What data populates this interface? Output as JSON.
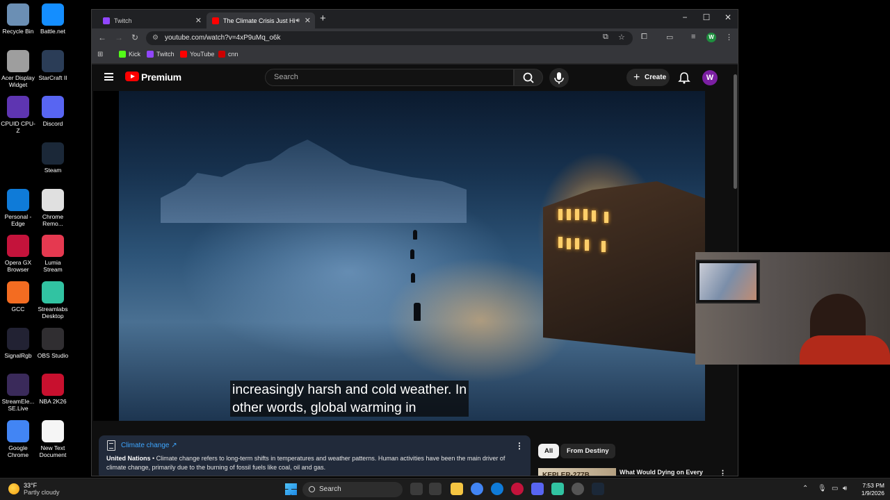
{
  "desktop": {
    "icons": [
      {
        "label": "Recycle Bin",
        "color": "#6b8fb4"
      },
      {
        "label": "Battle.net",
        "color": "#148eff"
      },
      {
        "label": "Acer Display Widget",
        "color": "#9e9e9e"
      },
      {
        "label": "StarCraft II",
        "color": "#2b3d57"
      },
      {
        "label": "CPUID CPU-Z",
        "color": "#5e35b1"
      },
      {
        "label": "Discord",
        "color": "#5865f2"
      },
      {
        "label": "Steam",
        "color": "#1b2838"
      },
      {
        "label": "Personal - Edge",
        "color": "#0f7bd8"
      },
      {
        "label": "Chrome Remo...",
        "color": "#e0e0e0"
      },
      {
        "label": "Opera GX Browser",
        "color": "#c4133b"
      },
      {
        "label": "Lumia Stream",
        "color": "#e53950"
      },
      {
        "label": "GCC",
        "color": "#f36c21"
      },
      {
        "label": "Streamlabs Desktop",
        "color": "#31c3a2"
      },
      {
        "label": "SignalRgb",
        "color": "#222233"
      },
      {
        "label": "OBS Studio",
        "color": "#302e31"
      },
      {
        "label": "StreamEle... SE.Live",
        "color": "#3a2a5a"
      },
      {
        "label": "NBA 2K26",
        "color": "#c8102e"
      },
      {
        "label": "Google Chrome",
        "color": "#4285f4"
      },
      {
        "label": "New Text Document",
        "color": "#f5f5f5"
      }
    ]
  },
  "browser": {
    "tabs": [
      {
        "label": "Twitch",
        "favicon_color": "#9146ff",
        "active": false
      },
      {
        "label": "The Climate Crisis Just Hit a",
        "favicon_color": "#ff0000",
        "active": true
      }
    ],
    "new_tab": "+",
    "window_controls": {
      "minimize": "−",
      "maximize": "☐",
      "close": "✕"
    },
    "url": "youtube.com/watch?v=4xP9uMq_o6k",
    "profile_initial": "W",
    "bookmarks": [
      {
        "label": "Kick",
        "color": "#53fc18"
      },
      {
        "label": "Twitch",
        "color": "#9146ff"
      },
      {
        "label": "YouTube",
        "color": "#ff0000"
      },
      {
        "label": "cnn",
        "color": "#cc0000"
      }
    ]
  },
  "youtube": {
    "brand": "Premium",
    "search_placeholder": "Search",
    "create_label": "Create",
    "avatar_initial": "W",
    "caption_line1": "increasingly harsh and cold weather. In",
    "caption_line2": "other words, global warming in",
    "info_panel": {
      "topic": "Climate change ↗",
      "source": "United Nations",
      "description": " • Climate change refers to long-term shifts in temperatures and weather patterns. Human activities have been the main driver of climate change, primarily due to the burning of fossil fuels like coal, oil and gas."
    },
    "chips": [
      "All",
      "From Destiny"
    ],
    "recommendation": {
      "thumb_text": "KEPLER-277B",
      "title": "What Would Dying on Every Planet in the Universe Be Like?"
    }
  },
  "taskbar": {
    "weather_temp": "33°F",
    "weather_condition": "Partly cloudy",
    "search_label": "Search",
    "time": "7:53 PM",
    "date": "1/9/2026"
  }
}
